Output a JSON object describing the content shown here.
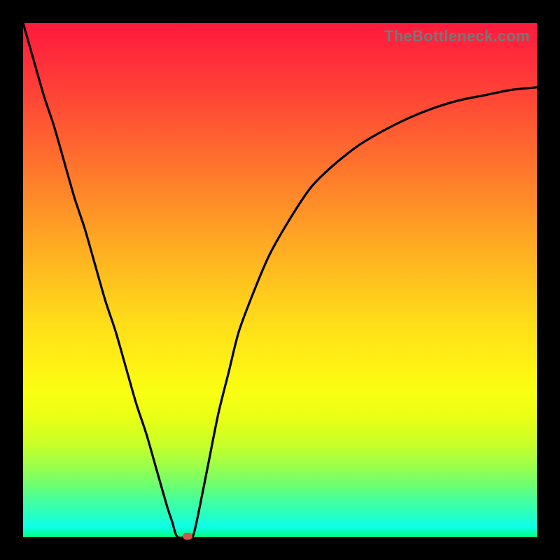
{
  "watermark": "TheBottleneck.com",
  "colors": {
    "frame": "#000000",
    "curve": "#000000",
    "marker": "#d1564a",
    "gradient_top": "#ff1b3f",
    "gradient_bottom": "#00ff80"
  },
  "chart_data": {
    "type": "line",
    "title": "",
    "xlabel": "",
    "ylabel": "",
    "xlim": [
      0,
      100
    ],
    "ylim": [
      0,
      100
    ],
    "series": [
      {
        "name": "bottleneck-curve",
        "x": [
          0,
          2,
          4,
          6,
          8,
          10,
          12,
          14,
          16,
          18,
          20,
          22,
          24,
          26,
          28,
          29,
          30,
          32,
          33,
          34,
          36,
          38,
          40,
          42,
          45,
          48,
          52,
          56,
          60,
          65,
          70,
          75,
          80,
          85,
          90,
          95,
          100
        ],
        "values": [
          100,
          93,
          86,
          80,
          73,
          66,
          60,
          53,
          46,
          40,
          33,
          26,
          20,
          13,
          6,
          3,
          0,
          0,
          0,
          4,
          14,
          24,
          32,
          40,
          48,
          55,
          62,
          68,
          72,
          76,
          79,
          81.5,
          83.5,
          85,
          86,
          87,
          87.5
        ]
      }
    ],
    "annotations": [
      {
        "name": "optimum-marker",
        "x": 32,
        "y": 0
      }
    ]
  }
}
